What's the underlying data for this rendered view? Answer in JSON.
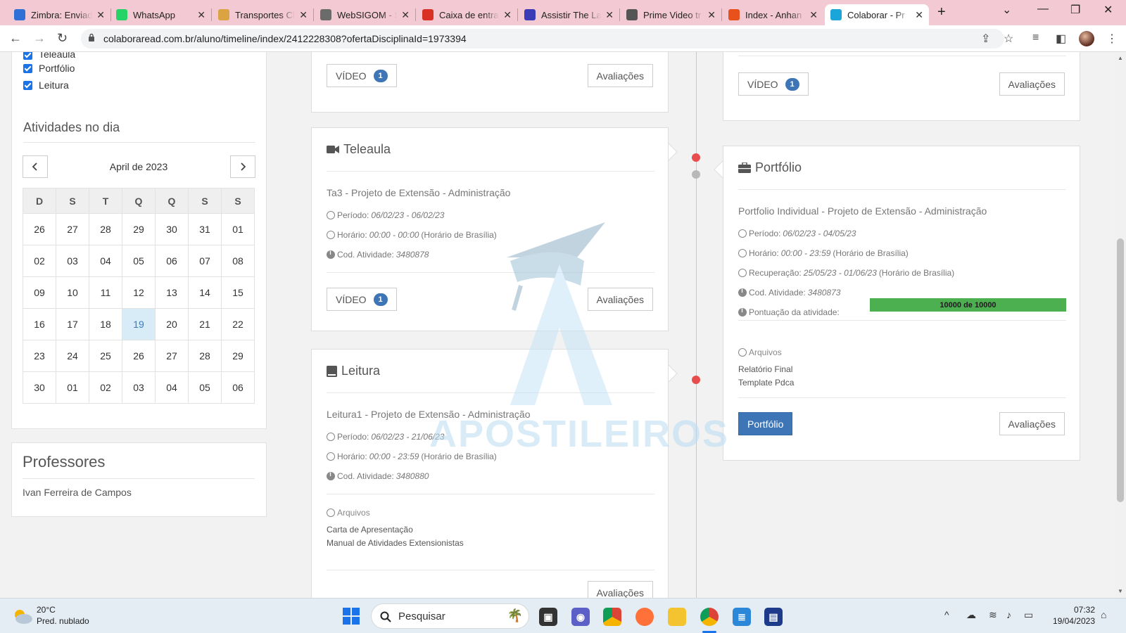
{
  "browser": {
    "tabs": [
      {
        "title": "Zimbra: Enviad",
        "icon": "zimbra-icon",
        "color": "#2f6fd6"
      },
      {
        "title": "WhatsApp",
        "icon": "whatsapp-icon",
        "color": "#25d366"
      },
      {
        "title": "Transportes Cl",
        "icon": "transport-icon",
        "color": "#d9a441"
      },
      {
        "title": "WebSIGOM - S",
        "icon": "websigom-icon",
        "color": "#6b6b6b"
      },
      {
        "title": "Caixa de entra",
        "icon": "gmail-icon",
        "color": "#d93025"
      },
      {
        "title": "Assistir The La",
        "icon": "play-icon",
        "color": "#3b3bb8"
      },
      {
        "title": "Prime Video tr",
        "icon": "globe-icon",
        "color": "#555555"
      },
      {
        "title": "Index - Anhan",
        "icon": "warning-icon",
        "color": "#e8501c"
      },
      {
        "title": "Colaborar - Pr",
        "icon": "colaborar-icon",
        "color": "#1ba5d8"
      }
    ],
    "url": "colaboraread.com.br/aluno/timeline/index/2412228308?ofertaDisciplinaId=1973394"
  },
  "sidebar": {
    "filters": [
      {
        "label": "Teleaula",
        "checked": true
      },
      {
        "label": "Portfólio",
        "checked": true
      },
      {
        "label": "Leitura",
        "checked": true
      }
    ],
    "activities_title": "Atividades no dia",
    "calendar": {
      "month_label": "April de 2023",
      "weekdays": [
        "D",
        "S",
        "T",
        "Q",
        "Q",
        "S",
        "S"
      ],
      "weeks": [
        [
          "26",
          "27",
          "28",
          "29",
          "30",
          "31",
          "01"
        ],
        [
          "02",
          "03",
          "04",
          "05",
          "06",
          "07",
          "08"
        ],
        [
          "09",
          "10",
          "11",
          "12",
          "13",
          "14",
          "15"
        ],
        [
          "16",
          "17",
          "18",
          "19",
          "20",
          "21",
          "22"
        ],
        [
          "23",
          "24",
          "25",
          "26",
          "27",
          "28",
          "29"
        ],
        [
          "30",
          "01",
          "02",
          "03",
          "04",
          "05",
          "06"
        ]
      ],
      "selected": "19"
    },
    "professors_title": "Professores",
    "professor_name": "Ivan Ferreira de Campos"
  },
  "timeline": {
    "top_left": {
      "video_label": "VÍDEO",
      "video_count": "1",
      "eval_label": "Avaliações"
    },
    "top_right": {
      "video_label": "VÍDEO",
      "video_count": "1",
      "eval_label": "Avaliações"
    },
    "teleaula": {
      "title": "Teleaula",
      "name": "Ta3 - Projeto de Extensão - Administração",
      "period_label": "Período:",
      "period": "06/02/23 - 06/02/23",
      "time_label": "Horário:",
      "time": "00:00 - 00:00",
      "tz": "(Horário de Brasília)",
      "code_label": "Cod. Atividade:",
      "code": "3480878",
      "video_label": "VÍDEO",
      "video_count": "1",
      "eval_label": "Avaliações"
    },
    "leitura": {
      "title": "Leitura",
      "name": "Leitura1 - Projeto de Extensão - Administração",
      "period_label": "Período:",
      "period": "06/02/23 - 21/06/23",
      "time_label": "Horário:",
      "time": "00:00 - 23:59",
      "tz": "(Horário de Brasília)",
      "code_label": "Cod. Atividade:",
      "code": "3480880",
      "files_label": "Arquivos",
      "files": [
        "Carta de Apresentação",
        "Manual de Atividades Extensionistas"
      ],
      "eval_label": "Avaliações"
    },
    "portfolio": {
      "title": "Portfólio",
      "name": "Portfolio Individual - Projeto de Extensão - Administração",
      "period_label": "Período:",
      "period": "06/02/23 - 04/05/23",
      "time_label": "Horário:",
      "time": "00:00 - 23:59",
      "tz": "(Horário de Brasília)",
      "recovery_label": "Recuperação:",
      "recovery": "25/05/23 - 01/06/23",
      "recovery_tz": "(Horário de Brasília)",
      "code_label": "Cod. Atividade:",
      "code": "3480873",
      "score_label": "Pontuação da atividade:",
      "score_text": "10000 de 10000",
      "score_fraction": 1.0,
      "files_label": "Arquivos",
      "files": [
        "Relatório Final",
        "Template Pdca"
      ],
      "action_label": "Portfólio",
      "eval_label": "Avaliações"
    },
    "watermark": "APOSTILEIROS"
  },
  "taskbar": {
    "temperature": "20°C",
    "weather": "Pred. nublado",
    "search_placeholder": "Pesquisar",
    "time": "07:32",
    "date": "19/04/2023"
  },
  "colors": {
    "accent": "#3e75b6",
    "progress": "#4caf50",
    "timeline_dot_active": "#e84c4c",
    "timeline_dot_inactive": "#b8b8b8",
    "tab_strip": "#f3c9d3"
  }
}
